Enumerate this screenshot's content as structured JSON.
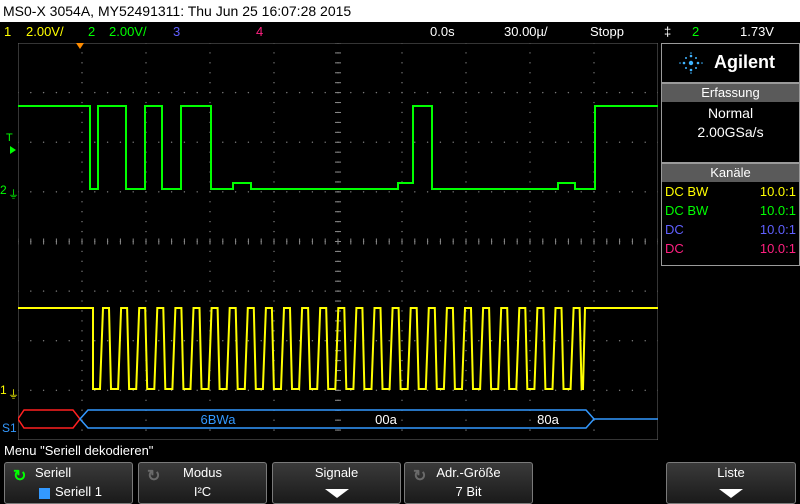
{
  "title": "MS0-X 3054A, MY52491311: Thu Jun 25 16:07:28 2015",
  "channel_bar": {
    "ch1_num": "1",
    "ch1_scale": "2.00V/",
    "ch2_num": "2",
    "ch2_scale": "2.00V/",
    "ch3_num": "3",
    "ch4_num": "4",
    "time_offset": "0.0s",
    "time_scale": "30.00µ/",
    "run_state": "Stopp",
    "trigger_symbol": "‡",
    "trigger_channel": "2",
    "trigger_level": "1.73V"
  },
  "brand": {
    "name": "Agilent"
  },
  "acquisition": {
    "heading": "Erfassung",
    "mode": "Normal",
    "rate": "2.00GSa/s"
  },
  "channels": {
    "heading": "Kanäle",
    "rows": [
      {
        "coupling": "DC BW",
        "probe": "10.0:1",
        "color": "#ffff00"
      },
      {
        "coupling": "DC BW",
        "probe": "10.0:1",
        "color": "#00ff00"
      },
      {
        "coupling": "DC",
        "probe": "10.0:1",
        "color": "#6060ff"
      },
      {
        "coupling": "DC",
        "probe": "10.0:1",
        "color": "#ff2080"
      }
    ]
  },
  "markers": {
    "ch2": "2",
    "ch1": "1",
    "serial": "S1",
    "trigger": "T"
  },
  "decode": {
    "fields": [
      "6BWa",
      "00a",
      "80a"
    ]
  },
  "menu_title": "Menu \"Seriell dekodieren\"",
  "softkeys": [
    {
      "label": "Seriell",
      "value": "Seriell 1"
    },
    {
      "label": "Modus",
      "value": "I²C"
    },
    {
      "label": "Signale",
      "value": ""
    },
    {
      "label": "Adr.-Größe",
      "value": "7 Bit"
    },
    {
      "label": "Liste",
      "value": ""
    }
  ],
  "colors": {
    "ch1": "#ffff00",
    "ch2": "#00ff00",
    "ch3": "#6060ff",
    "ch4": "#ff2080",
    "decode": "#3399ff",
    "error": "#ff2020"
  }
}
